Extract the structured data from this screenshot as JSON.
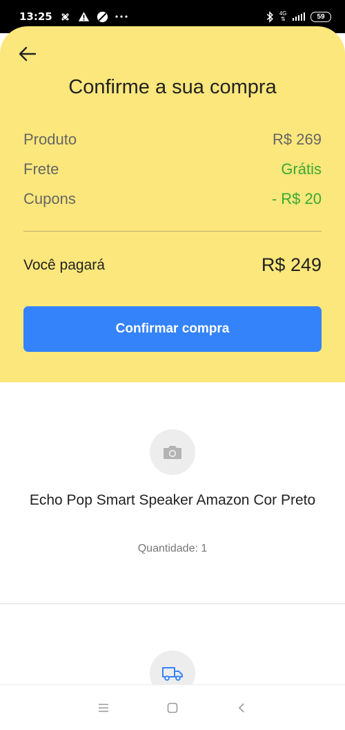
{
  "status_bar": {
    "time": "13:25",
    "network": "4G",
    "battery": "59",
    "icons": [
      "fan-icon",
      "alert-icon",
      "blocked-icon",
      "more-dots-icon",
      "bluetooth-icon",
      "signal-icon",
      "battery-icon"
    ]
  },
  "summary": {
    "title": "Confirme a sua compra",
    "rows": [
      {
        "label": "Produto",
        "value": "R$ 269",
        "color": "#666666"
      },
      {
        "label": "Frete",
        "value": "Grátis",
        "color": "#3aa832"
      },
      {
        "label": "Cupons",
        "value": "- R$ 20",
        "color": "#3aa832"
      }
    ],
    "total_label": "Você pagará",
    "total_value": "R$ 249",
    "confirm_label": "Confirmar compra",
    "background": "#fbe77b",
    "button_color": "#3483fa"
  },
  "product": {
    "name": "Echo Pop Smart Speaker Amazon Cor Preto",
    "quantity": "Quantidade: 1",
    "icon": "camera-icon"
  },
  "shipping": {
    "icon": "truck-icon"
  },
  "navbar": {
    "icons": [
      "menu-icon",
      "home-square-icon",
      "back-chevron-icon"
    ]
  }
}
